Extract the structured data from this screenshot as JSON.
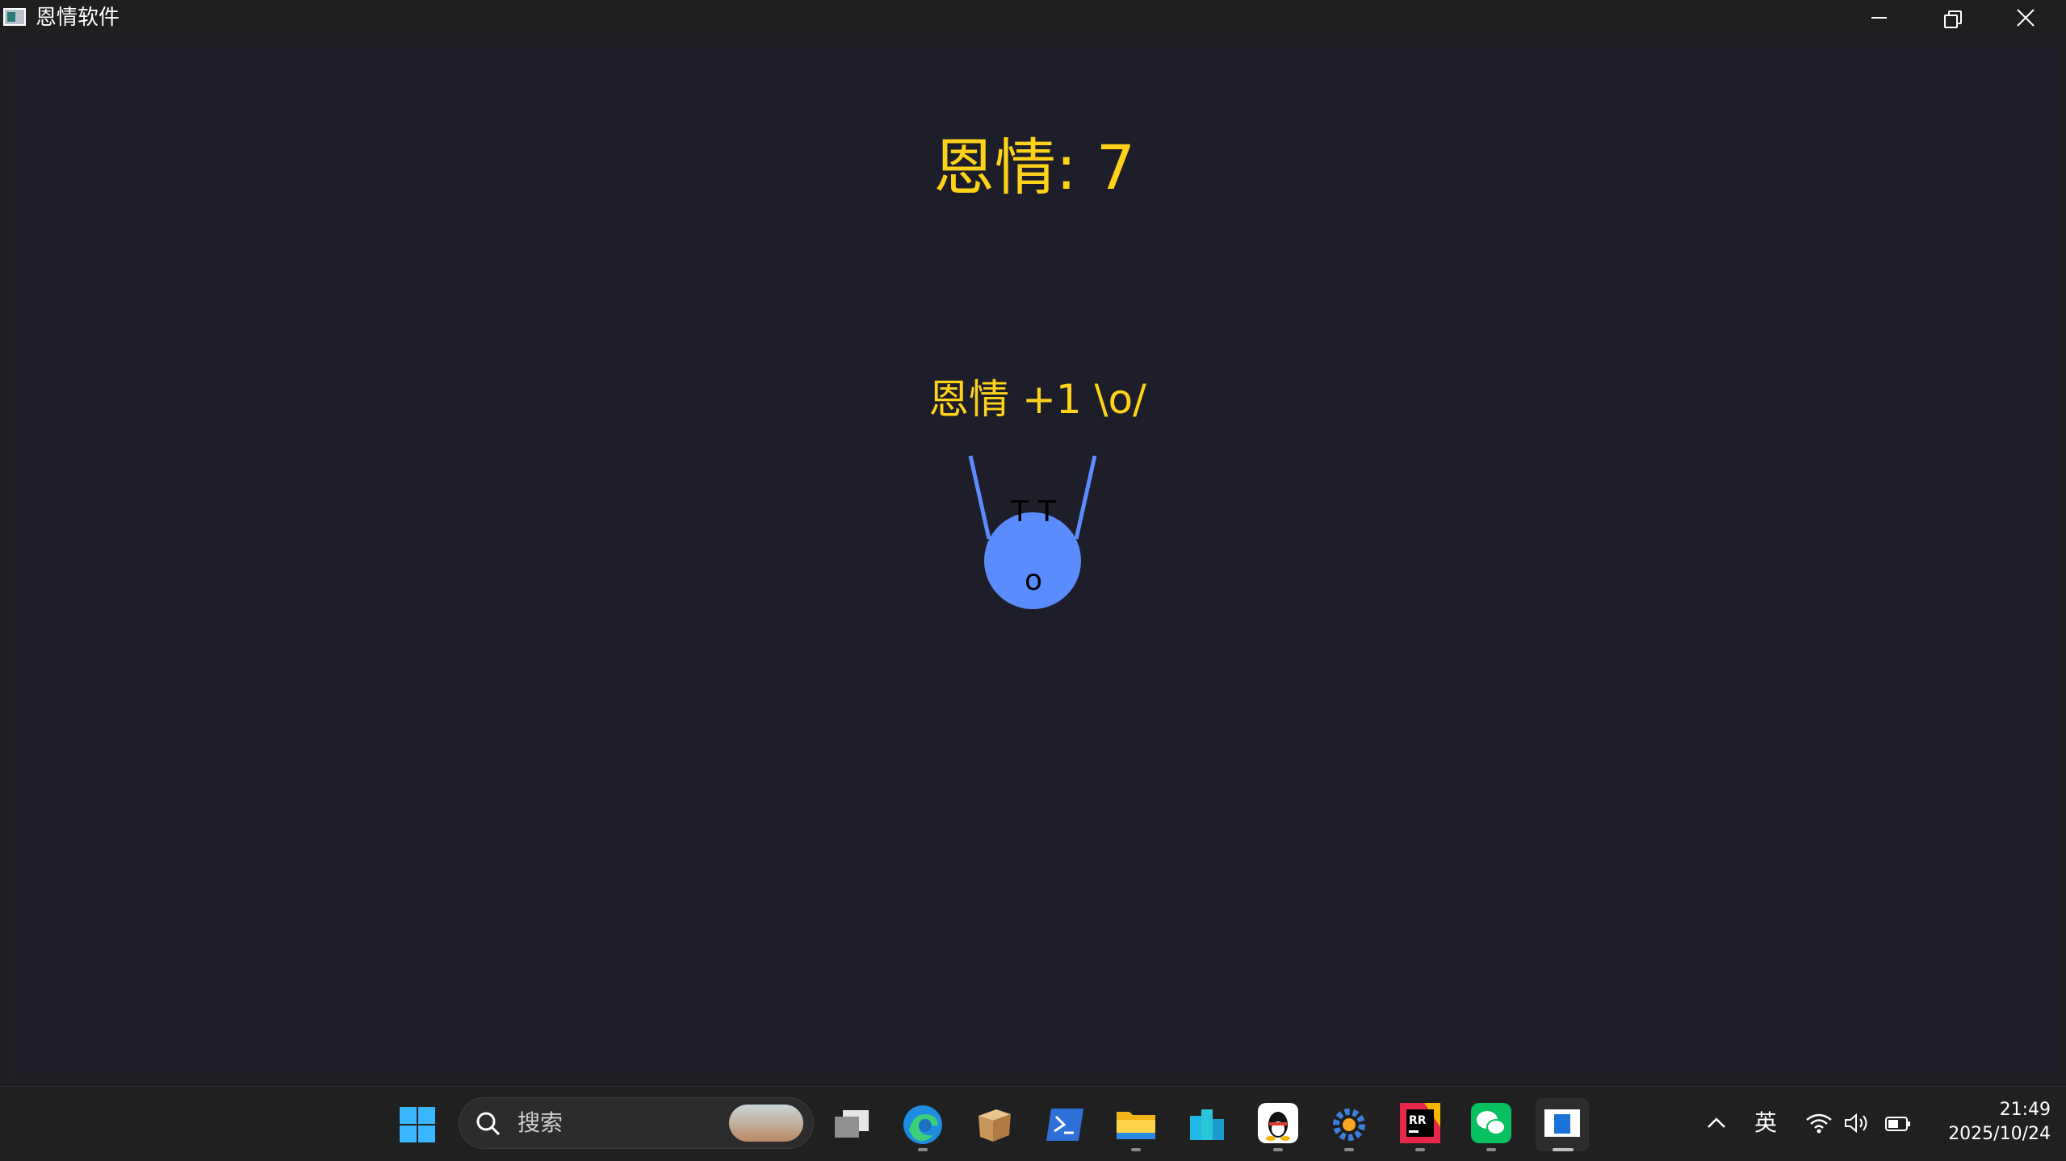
{
  "window": {
    "title": "恩情软件"
  },
  "game": {
    "score_label": "恩情: 7",
    "popup": "恩情 +1 \\o/",
    "creature_eyes": "T T",
    "creature_mouth": "o",
    "accent_color": "#ffd21a",
    "creature_color": "#5b8cff"
  },
  "taskbar": {
    "search_placeholder": "搜索",
    "apps": [
      "start-icon",
      "task-view-icon",
      "edge-icon",
      "package-icon",
      "terminal-icon",
      "file-explorer-icon",
      "cloud-db-icon",
      "qq-icon",
      "settings-gear-icon",
      "rider-ide-icon",
      "wechat-icon",
      "active-window-icon"
    ],
    "tray": {
      "input_method": "英",
      "time": "21:49",
      "date": "2025/10/24"
    }
  }
}
